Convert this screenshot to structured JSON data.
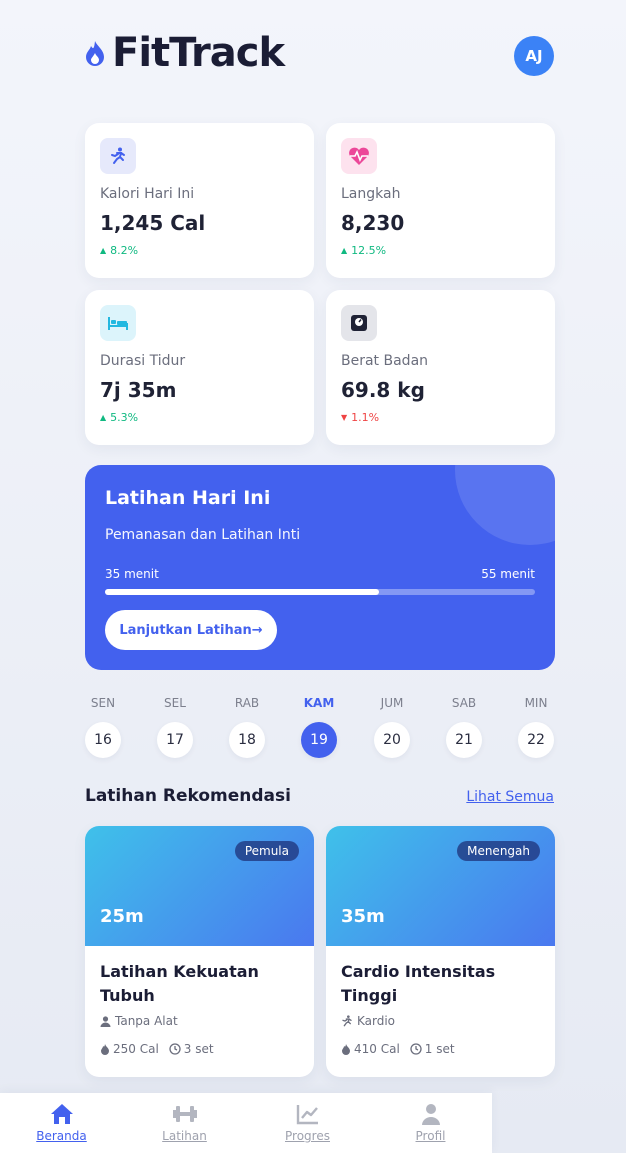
{
  "app": {
    "name": "FitTrack",
    "avatar_initials": "AJ",
    "accent": "#4361ee"
  },
  "stats": [
    {
      "label": "Kalori Hari Ini",
      "value": "1,245 Cal",
      "change": "8.2%",
      "trend": "up",
      "icon": "running-icon",
      "icon_color": "#4361ee",
      "icon_bg": "#e6e9fb"
    },
    {
      "label": "Langkah",
      "value": "8,230",
      "change": "12.5%",
      "trend": "up",
      "icon": "heartbeat-icon",
      "icon_color": "#ec4899",
      "icon_bg": "#fde2ee"
    },
    {
      "label": "Durasi Tidur",
      "value": "7j 35m",
      "change": "5.3%",
      "trend": "up",
      "icon": "bed-icon",
      "icon_color": "#22b8e0",
      "icon_bg": "#dcf4fb"
    },
    {
      "label": "Berat Badan",
      "value": "69.8 kg",
      "change": "1.1%",
      "trend": "down",
      "icon": "scale-icon",
      "icon_color": "#1f2235",
      "icon_bg": "#e4e5ea"
    }
  ],
  "workout": {
    "title": "Latihan Hari Ini",
    "subtitle": "Pemanasan dan Latihan Inti",
    "progress_current": "35 menit",
    "progress_total": "55 menit",
    "progress_fraction": 0.6364,
    "button_label": "Lanjutkan Latihan"
  },
  "days": [
    {
      "name": "SEN",
      "num": "16",
      "active": false
    },
    {
      "name": "SEL",
      "num": "17",
      "active": false
    },
    {
      "name": "RAB",
      "num": "18",
      "active": false
    },
    {
      "name": "KAM",
      "num": "19",
      "active": true
    },
    {
      "name": "JUM",
      "num": "20",
      "active": false
    },
    {
      "name": "SAB",
      "num": "21",
      "active": false
    },
    {
      "name": "MIN",
      "num": "22",
      "active": false
    }
  ],
  "recommendations": {
    "title": "Latihan Rekomendasi",
    "link": "Lihat Semua",
    "items": [
      {
        "badge": "Pemula",
        "duration": "25m",
        "title": "Latihan Kekuatan Tubuh",
        "meta": "Tanpa Alat",
        "meta_icon": "user-icon",
        "calories": "250 Cal",
        "sets": "3 set"
      },
      {
        "badge": "Menengah",
        "duration": "35m",
        "title": "Cardio Intensitas Tinggi",
        "meta": "Kardio",
        "meta_icon": "running-icon",
        "calories": "410 Cal",
        "sets": "1 set"
      }
    ]
  },
  "nav": [
    {
      "label": "Beranda",
      "icon": "home-icon",
      "active": true
    },
    {
      "label": "Latihan",
      "icon": "dumbbell-icon",
      "active": false
    },
    {
      "label": "Progres",
      "icon": "chart-line-icon",
      "active": false
    },
    {
      "label": "Profil",
      "icon": "user-icon",
      "active": false
    }
  ]
}
